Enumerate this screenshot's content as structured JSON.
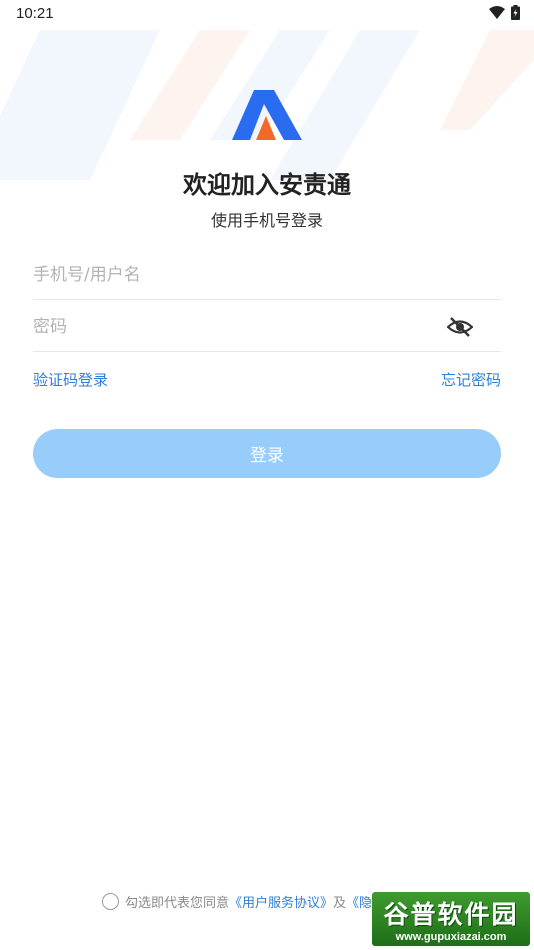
{
  "status_bar": {
    "time": "10:21"
  },
  "header": {
    "title": "欢迎加入安责通",
    "subtitle": "使用手机号登录"
  },
  "form": {
    "phone_placeholder": "手机号/用户名",
    "password_placeholder": "密码",
    "code_login_link": "验证码登录",
    "forgot_link": "忘记密码",
    "login_button": "登录"
  },
  "agreement": {
    "prefix": "勾选即代表您同意",
    "user_agreement": "《用户服务协议》",
    "and": "及",
    "privacy": "《隐"
  },
  "watermark": {
    "text": "谷普软件园",
    "url": "www.gupuxiazai.com"
  },
  "colors": {
    "accent": "#2d7fd8",
    "button": "#98cdfb",
    "logo_blue": "#2a6cf0",
    "logo_orange": "#f26a2a"
  }
}
